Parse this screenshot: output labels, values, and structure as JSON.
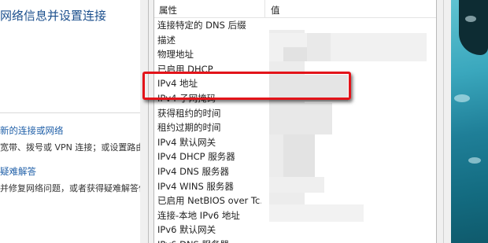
{
  "left_panel": {
    "title": "网络信息并设置连接",
    "links": [
      {
        "label": "新的连接或网络",
        "desc": "宽带、拨号或 VPN 连接；或设置路由"
      },
      {
        "label": "疑难解答",
        "desc": "并修复网络问题，或者获得疑难解答信"
      }
    ]
  },
  "details": {
    "headers": {
      "property": "属性",
      "value": "值"
    },
    "rows": [
      "连接特定的 DNS 后缀",
      "描述",
      "物理地址",
      "已启用 DHCP",
      "IPv4 地址",
      "IPv4 子网掩码",
      "获得租约的时间",
      "租约过期的时间",
      "IPv4 默认网关",
      "IPv4 DHCP 服务器",
      "IPv4 DNS 服务器",
      "IPv4 WINS 服务器",
      "已启用 NetBIOS over Tc...",
      "连接-本地 IPv6 地址",
      "IPv6 默认网关",
      "IPv6 DNS 服务器"
    ]
  },
  "colors": {
    "highlight": "#e3141a",
    "link": "#1f5fa8",
    "title": "#1a4e8c"
  },
  "icons": {
    "highlight_box": "red-annotation-rectangle"
  }
}
